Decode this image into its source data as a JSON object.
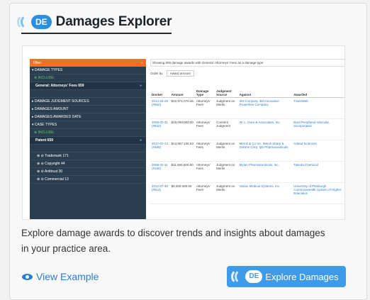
{
  "card": {
    "logo_text": "DE",
    "title": "Damages Explorer",
    "description": "Explore damage awards to discover trends and insights about damages in your practice area.",
    "view_example_label": "View Example",
    "explore_button_label": "Explore Damages",
    "explore_logo_text": "DE"
  },
  "preview": {
    "sidebar": {
      "filter_label": "Filter",
      "rows": [
        {
          "label": "▾ DAMAGE TYPES",
          "kind": "header"
        },
        {
          "label": "⊕ INCLUDE:",
          "kind": "green"
        },
        {
          "label": "General: Attorneys' Fees 659",
          "kind": "sel"
        },
        {
          "label": "",
          "kind": "blank"
        },
        {
          "label": "▸ DAMAGE JUDGMENT SOURCES",
          "kind": "header"
        },
        {
          "label": "▸ DAMAGES AMOUNT",
          "kind": "header"
        },
        {
          "label": "▸ DAMAGES AWARDED DATE",
          "kind": "header"
        },
        {
          "label": "▾ CASE TYPES",
          "kind": "header"
        },
        {
          "label": "⊕ INCLUDE:",
          "kind": "green"
        },
        {
          "label": "Patent 659",
          "kind": "sel"
        },
        {
          "label": "",
          "kind": "blank"
        },
        {
          "label": "⊕ ⊖ Trademark 171",
          "kind": "sub"
        },
        {
          "label": "⊕ ⊖ Copyright 44",
          "kind": "sub"
        },
        {
          "label": "⊕ ⊖ Antitrust 30",
          "kind": "sub"
        },
        {
          "label": "⊕ ⊖ Commercial 13",
          "kind": "sub"
        }
      ]
    },
    "showing_text": "Showing 659 damage awards  with General: Attorneys' Fees as a damage type",
    "order_label": "Order by",
    "order_value": "Award amount",
    "columns": [
      "Docket",
      "Amount",
      "Damage Type",
      "Judgment Source",
      "Against",
      "Awarded"
    ],
    "rows": [
      {
        "docket": "2014-04-29 (#582)",
        "amount": "$22,971,070.46",
        "type": "Attorneys' Fees",
        "source": "Judgment on Merits",
        "against": "3M Company 3M Innovative Properties Company",
        "awarded": "TransWeb"
      },
      {
        "docket": "2008-02-31 (#842)",
        "amount": "$19,000,000.00",
        "type": "Attorneys' Fees",
        "source": "Consent Judgment",
        "against": "W. L. Gore & Associates, Inc.",
        "awarded": "Bard Peripheral Vascular, Incorporated"
      },
      {
        "docket": "2017-07-14 (#489)",
        "amount": "$13,957,106.53",
        "type": "Attorneys' Fees",
        "source": "Judgment on Merits",
        "against": "Merck & Co Inc. Merck Sharp & Dohme Corp. Ipb Pharmaceuticals",
        "awarded": "Gilead Sciences"
      },
      {
        "docket": "2008-02-11 (#190)",
        "amount": "$11,000,000.00",
        "type": "Attorneys' Fees",
        "source": "Judgment on Merits",
        "against": "Mylan Pharmaceuticals, Inc.",
        "awarded": "Takeda Chemical"
      },
      {
        "docket": "2012-07-30 (#514)",
        "amount": "$9,300,000.00",
        "type": "Attorneys' Fees",
        "source": "Judgment on Merits",
        "against": "Varian Medical Systems, Inc.",
        "awarded": "University of Pittsburgh Commonwealth System of Higher Education"
      }
    ]
  }
}
